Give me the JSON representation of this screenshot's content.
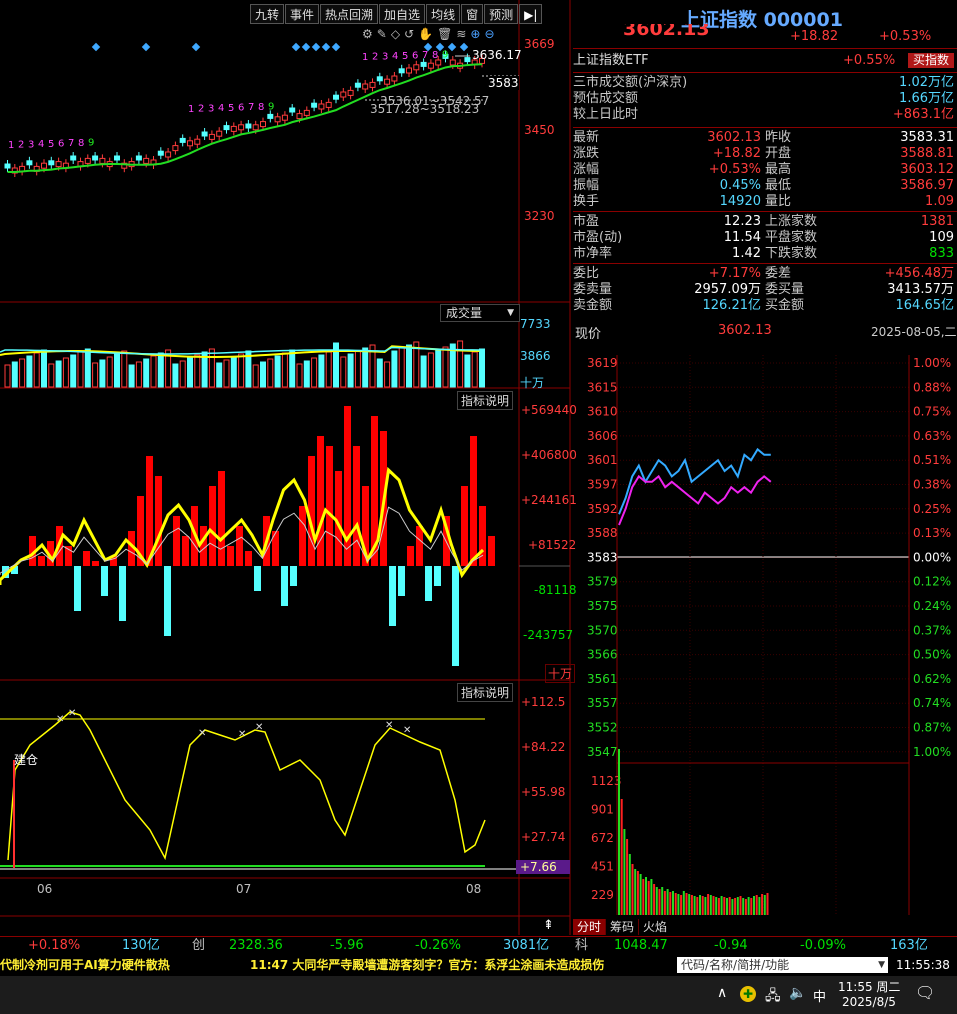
{
  "toolbar": {
    "buttons": [
      "九转",
      "事件",
      "热点回溯",
      "加自选",
      "均线",
      "窗",
      "预测"
    ]
  },
  "header": {
    "title": "上证指数 000001",
    "price_cut": "3602.13",
    "change": "+18.82",
    "change_pct": "+0.53%"
  },
  "etf": {
    "label": "上证指数ETF",
    "pct": "+0.55%",
    "buy_button": "买指数"
  },
  "market": {
    "rows": [
      {
        "label": "三市成交额(沪深京)",
        "value": "1.02万亿"
      },
      {
        "label": "预估成交额",
        "value": "1.66万亿"
      },
      {
        "label": "较上日此时",
        "value": "+863.1亿"
      }
    ]
  },
  "stats": {
    "rows": [
      {
        "l": "最新",
        "lv": "3602.13",
        "lc": "red",
        "r": "昨收",
        "rv": "3583.31",
        "rc": "white"
      },
      {
        "l": "涨跌",
        "lv": "+18.82",
        "lc": "red",
        "r": "开盘",
        "rv": "3588.81",
        "rc": "red"
      },
      {
        "l": "涨幅",
        "lv": "+0.53%",
        "lc": "red",
        "r": "最高",
        "rv": "3603.12",
        "rc": "red"
      },
      {
        "l": "振幅",
        "lv": "0.45%",
        "lc": "cyan",
        "r": "最低",
        "rv": "3586.97",
        "rc": "red"
      },
      {
        "l": "换手",
        "lv": "14920",
        "lc": "cyan",
        "r": "量比",
        "rv": "1.09",
        "rc": "red"
      },
      {
        "l": "市盈",
        "lv": "12.23",
        "lc": "white",
        "r": "上涨家数",
        "rv": "1381",
        "rc": "red"
      },
      {
        "l": "市盈(动)",
        "lv": "11.54",
        "lc": "white",
        "r": "平盘家数",
        "rv": "109",
        "rc": "white"
      },
      {
        "l": "市净率",
        "lv": "1.42",
        "lc": "white",
        "r": "下跌家数",
        "rv": "833",
        "rc": "green"
      },
      {
        "l": "委比",
        "lv": "+7.17%",
        "lc": "red",
        "r": "委差",
        "rv": "+456.48万",
        "rc": "red"
      },
      {
        "l": "委卖量",
        "lv": "2957.09万",
        "lc": "white",
        "r": "委买量",
        "rv": "3413.57万",
        "rc": "white"
      },
      {
        "l": "卖金额",
        "lv": "126.21亿",
        "lc": "cyan",
        "r": "买金额",
        "rv": "164.65亿",
        "rc": "cyan"
      }
    ]
  },
  "intraday": {
    "now_label": "现价",
    "now_value": "3602.13",
    "date": "2025-08-05,二",
    "price_ticks": [
      "3619",
      "3615",
      "3610",
      "3606",
      "3601",
      "3597",
      "3592",
      "3588",
      "3583",
      "3579",
      "3575",
      "3570",
      "3566",
      "3561",
      "3557",
      "3552",
      "3547"
    ],
    "pct_ticks": [
      "1.00%",
      "0.88%",
      "0.75%",
      "0.63%",
      "0.51%",
      "0.38%",
      "0.25%",
      "0.13%",
      "0.00%",
      "0.12%",
      "0.24%",
      "0.37%",
      "0.50%",
      "0.62%",
      "0.74%",
      "0.87%",
      "1.00%"
    ],
    "vol_ticks": [
      "1123",
      "901",
      "672",
      "451",
      "229"
    ],
    "tabs": [
      "分时",
      "筹码",
      "火焰"
    ]
  },
  "kline": {
    "price_axis": [
      "3669",
      "3450",
      "3230"
    ],
    "annot_high": "3636.17",
    "annot_mid": "3583",
    "annot_line1": "3536.01~3542.57",
    "annot_line2": "3517.28~3518.23",
    "months": [
      "06",
      "07",
      "08"
    ],
    "volume_label": "成交量",
    "volume_axis": [
      "7733",
      "3866"
    ],
    "volume_unit": "十万",
    "ind1_label": "指标说明",
    "ind1_axis": [
      "+569440",
      "+406800",
      "+244161",
      "+81522",
      "-81118",
      "-243757"
    ],
    "ind1_unit": "十万",
    "ind2_label": "指标说明",
    "ind2_axis": [
      "+112.5",
      "+84.22",
      "+55.98",
      "+27.74",
      "+7.66"
    ],
    "ind2_tag": "建仓",
    "nine_seq": [
      "1",
      "2",
      "3",
      "4",
      "5",
      "6",
      "7",
      "8",
      "9"
    ]
  },
  "bottom": {
    "left": [
      {
        "v": "+0.18%",
        "c": "red"
      },
      {
        "v": "130亿",
        "c": "cyan"
      },
      {
        "v": "创",
        "c": "gray"
      },
      {
        "v": "2328.36",
        "c": "green"
      },
      {
        "v": "-5.96",
        "c": "green"
      },
      {
        "v": "-0.26%",
        "c": "green"
      },
      {
        "v": "3081亿",
        "c": "cyan"
      }
    ],
    "right": [
      {
        "v": "科",
        "c": "gray"
      },
      {
        "v": "1048.47",
        "c": "green"
      },
      {
        "v": "-0.94",
        "c": "green"
      },
      {
        "v": "-0.09%",
        "c": "green"
      },
      {
        "v": "163亿",
        "c": "cyan"
      }
    ]
  },
  "ticker": {
    "news1": "代制冷剂可用于AI算力硬件散热",
    "news2": "11:47 大同华严寺殿墙遭游客刻字？官方：系浮尘涂画未造成损伤",
    "search_placeholder": "代码/名称/简拼/功能",
    "clock": "11:55:38"
  },
  "taskbar": {
    "time": "11:55 周二",
    "date": "2025/8/5",
    "ime": "中"
  },
  "colors": {
    "up": "#ff3c3c",
    "down": "#55ffff",
    "ma": "#22dd22",
    "yellow": "#ffff00",
    "purple": "#ee22ee"
  },
  "chart_data": [
    {
      "type": "line",
      "title": "",
      "x_label": "",
      "y_label": "",
      "series": [
        {
          "name": "",
          "values": [
            3591,
            3594,
            3598,
            3600,
            3597,
            3599,
            3601,
            3600,
            3598,
            3599,
            3601,
            3597,
            3598,
            3599,
            3600,
            3601,
            3599,
            3600,
            3598,
            3602,
            3601,
            3603,
            3602,
            3602
          ]
        },
        {
          "name": "",
          "values": [
            3589,
            3592,
            3596,
            3598,
            3597,
            3597,
            3598,
            3596,
            3597,
            3596,
            3595,
            3594,
            3593,
            3595,
            3594,
            3593,
            3594,
            3596,
            3595,
            3596,
            3595,
            3597,
            3598,
            3597
          ]
        }
      ],
      "ylim": [
        3547,
        3619
      ]
    }
  ]
}
